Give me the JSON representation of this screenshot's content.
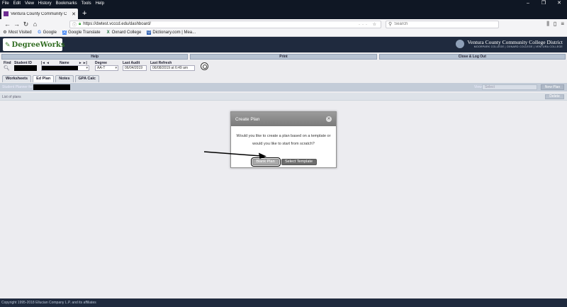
{
  "browser": {
    "menu": [
      "File",
      "Edit",
      "View",
      "History",
      "Bookmarks",
      "Tools",
      "Help"
    ],
    "tab_title": "Ventura County Community C",
    "url": "https://dwtest.vcccd.edu/dashboard/",
    "search_placeholder": "Search",
    "bookmarks": [
      "Most Visited",
      "Google",
      "Google Translate",
      "Oxnard College",
      "Dictionary.com | Mea..."
    ]
  },
  "header": {
    "logo_text": "DegreeWorks",
    "district_name": "Ventura County Community College District",
    "district_sub": "MOORPARK COLLEGE | OXNARD COLLEGE | VENTURA COLLEGE"
  },
  "topnav": [
    "Help",
    "Print",
    "Close & Log Out"
  ],
  "student": {
    "find_label": "Find",
    "id_label": "Student ID",
    "name_label": "Name",
    "degree_label": "Degree",
    "degree_value": "AA-T",
    "last_audit_label": "Last Audit",
    "last_audit_value": "06/04/2019",
    "last_refresh_label": "Last Refresh",
    "last_refresh_value": "06/08/2019 at 6:49 am"
  },
  "subtabs": [
    "Worksheets",
    "Ed Plan",
    "Notes",
    "GPA Calc"
  ],
  "planner": {
    "label": "Student Planner for",
    "view_label": "View",
    "view_placeholder": "Select",
    "new_plan": "New Plan"
  },
  "plans": {
    "list_label": "List of plans",
    "delete_label": "Delete"
  },
  "modal": {
    "title": "Create Plan",
    "line1": "Would you like to create a plan based on a template or",
    "line2": "would you like to start from scratch?",
    "blank_button": "Blank Plan",
    "template_button": "Select Template"
  },
  "footer": "Copyright 1995-2018 Ellucian Company L.P. and its affiliates",
  "colors": {
    "header_bg": "#1f2a3e",
    "nav_button": "#b7c3d3",
    "logo_green": "#2f6b1f"
  }
}
